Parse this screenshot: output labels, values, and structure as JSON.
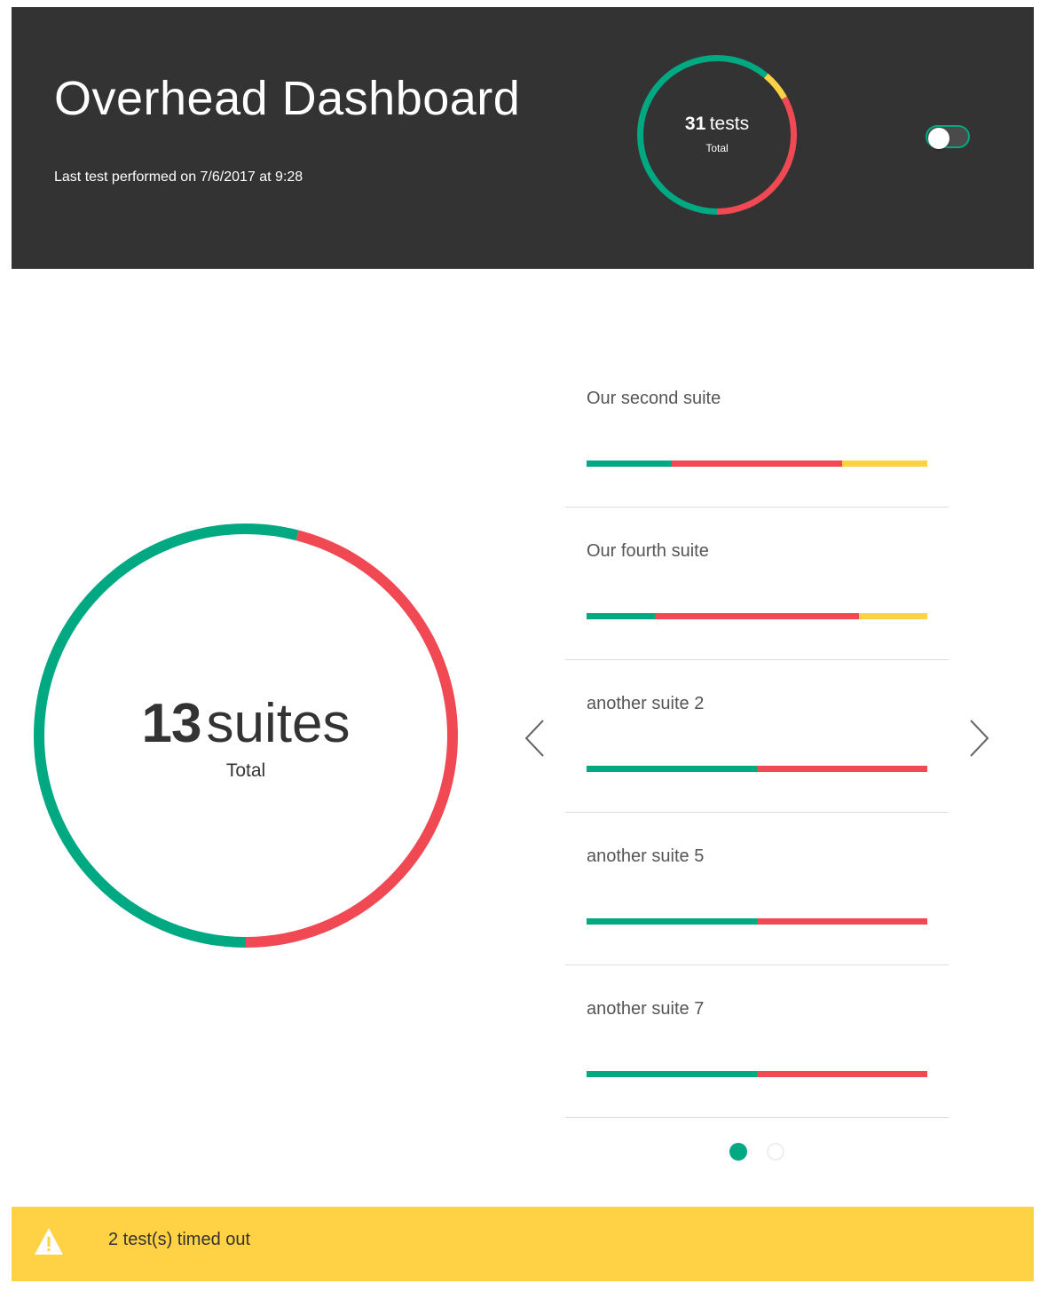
{
  "header": {
    "title": "Overhead Dashboard",
    "last_test": "Last test performed on 7/6/2017 at 9:28"
  },
  "colors": {
    "passed": "#01a982",
    "failed": "#f04953",
    "timed_out": "#ffd144",
    "header_bg": "#333333"
  },
  "tests_summary": {
    "count": "31",
    "unit": "tests",
    "label": "Total",
    "segments": [
      {
        "status": "passed",
        "fraction": 0.61
      },
      {
        "status": "timed_out",
        "fraction": 0.06
      },
      {
        "status": "failed",
        "fraction": 0.33
      }
    ]
  },
  "view_toggle": {
    "state": "off"
  },
  "suites_summary": {
    "count": "13",
    "unit": "suites",
    "label": "Total",
    "segments": [
      {
        "status": "passed",
        "fraction": 0.54
      },
      {
        "status": "failed",
        "fraction": 0.46
      }
    ]
  },
  "suites": [
    {
      "name": "Our second suite",
      "passed": 0.25,
      "failed": 0.5,
      "timed_out": 0.25
    },
    {
      "name": "Our fourth suite",
      "passed": 0.2,
      "failed": 0.6,
      "timed_out": 0.2
    },
    {
      "name": "another suite 2",
      "passed": 0.5,
      "failed": 0.5,
      "timed_out": 0
    },
    {
      "name": "another suite 5",
      "passed": 0.5,
      "failed": 0.5,
      "timed_out": 0
    },
    {
      "name": "another suite 7",
      "passed": 0.5,
      "failed": 0.5,
      "timed_out": 0
    }
  ],
  "pagination": {
    "pages": 2,
    "current": 1
  },
  "icons": {
    "prev": "chevron-left-icon",
    "next": "chevron-right-icon",
    "alert": "warning-icon"
  },
  "alert": {
    "message": "2 test(s) timed out"
  }
}
